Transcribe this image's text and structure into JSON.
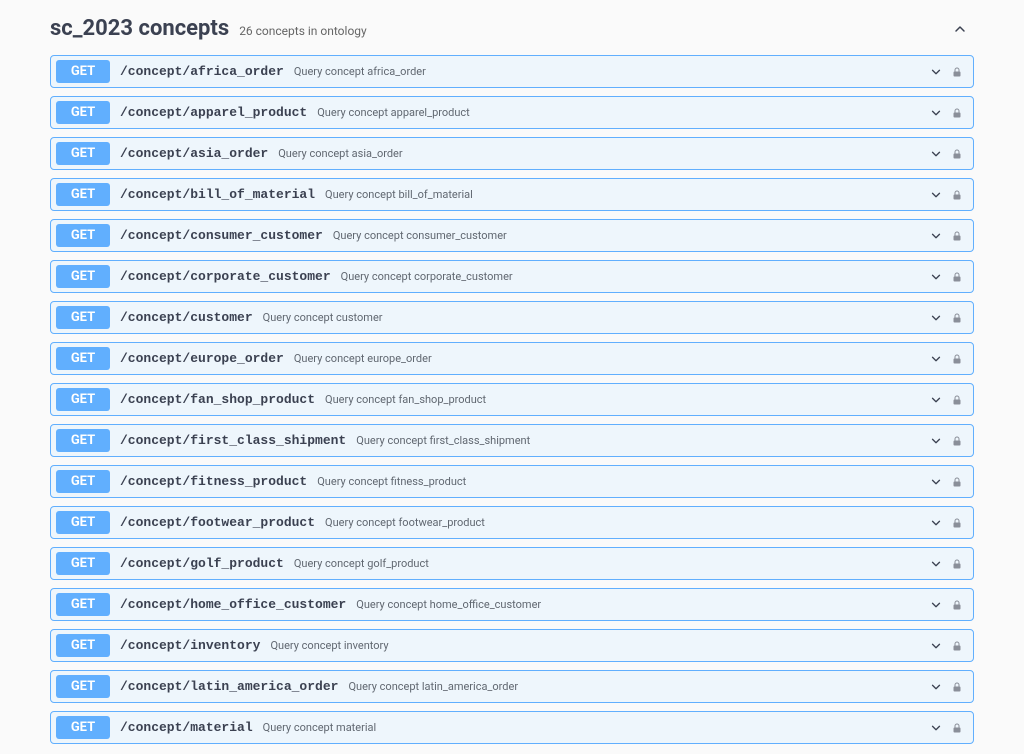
{
  "section": {
    "title": "sc_2023 concepts",
    "subtitle": "26 concepts in ontology"
  },
  "method_label": "GET",
  "endpoints": [
    {
      "path": "/concept/africa_order",
      "desc": "Query concept africa_order"
    },
    {
      "path": "/concept/apparel_product",
      "desc": "Query concept apparel_product"
    },
    {
      "path": "/concept/asia_order",
      "desc": "Query concept asia_order"
    },
    {
      "path": "/concept/bill_of_material",
      "desc": "Query concept bill_of_material"
    },
    {
      "path": "/concept/consumer_customer",
      "desc": "Query concept consumer_customer"
    },
    {
      "path": "/concept/corporate_customer",
      "desc": "Query concept corporate_customer"
    },
    {
      "path": "/concept/customer",
      "desc": "Query concept customer"
    },
    {
      "path": "/concept/europe_order",
      "desc": "Query concept europe_order"
    },
    {
      "path": "/concept/fan_shop_product",
      "desc": "Query concept fan_shop_product"
    },
    {
      "path": "/concept/first_class_shipment",
      "desc": "Query concept first_class_shipment"
    },
    {
      "path": "/concept/fitness_product",
      "desc": "Query concept fitness_product"
    },
    {
      "path": "/concept/footwear_product",
      "desc": "Query concept footwear_product"
    },
    {
      "path": "/concept/golf_product",
      "desc": "Query concept golf_product"
    },
    {
      "path": "/concept/home_office_customer",
      "desc": "Query concept home_office_customer"
    },
    {
      "path": "/concept/inventory",
      "desc": "Query concept inventory"
    },
    {
      "path": "/concept/latin_america_order",
      "desc": "Query concept latin_america_order"
    },
    {
      "path": "/concept/material",
      "desc": "Query concept material"
    }
  ]
}
